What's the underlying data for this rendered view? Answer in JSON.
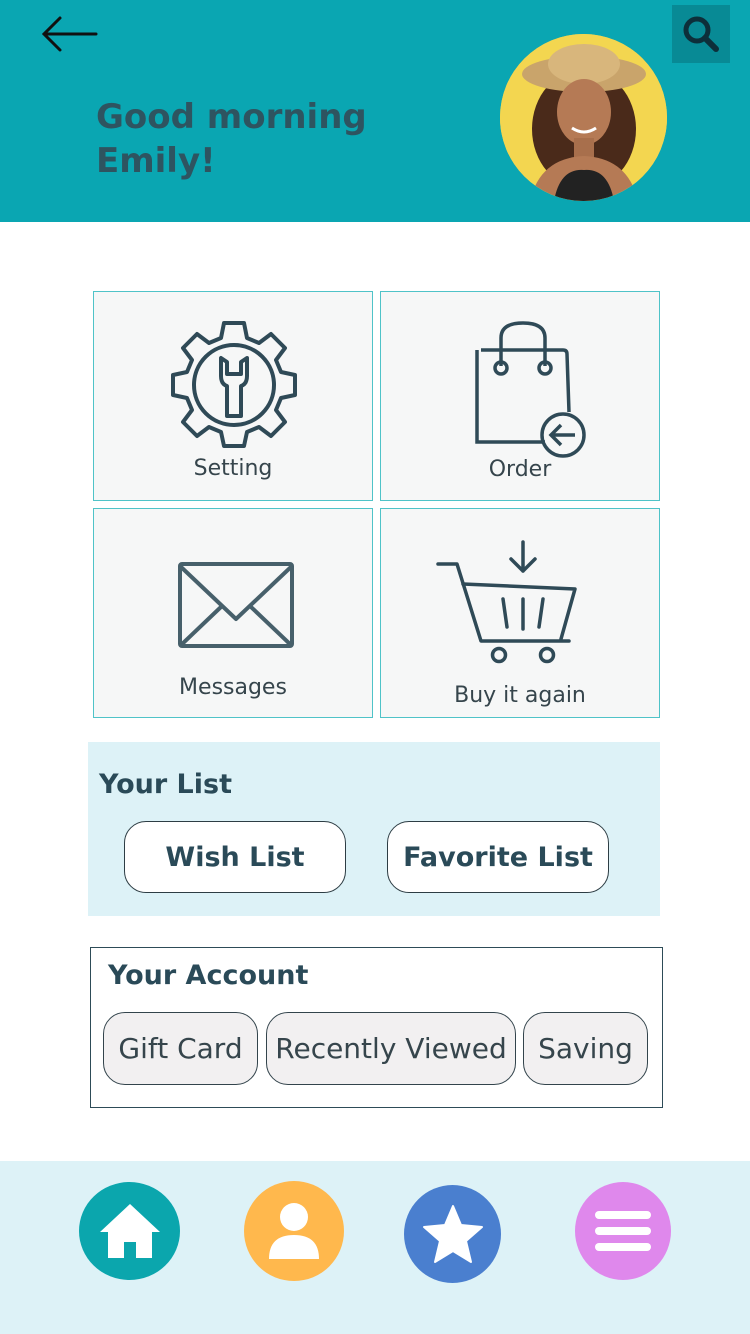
{
  "header": {
    "greeting_line1": "Good morning",
    "greeting_line2": "Emily!",
    "back_icon": "arrow-left-icon",
    "search_icon": "search-icon",
    "bg_color": "#0aa6b2"
  },
  "tiles": [
    {
      "label": "Setting",
      "icon": "gear-wrench-icon"
    },
    {
      "label": "Order",
      "icon": "shopping-bag-return-icon"
    },
    {
      "label": "Messages",
      "icon": "envelope-icon"
    },
    {
      "label": "Buy it again",
      "icon": "cart-download-icon"
    }
  ],
  "your_list": {
    "title": "Your List",
    "buttons": [
      "Wish List",
      "Favorite List"
    ]
  },
  "your_account": {
    "title": "Your Account",
    "buttons": [
      "Gift Card",
      "Recently Viewed",
      "Saving"
    ]
  },
  "bottom_nav": [
    {
      "name": "home",
      "icon": "home-icon",
      "color": "#0ba6ad"
    },
    {
      "name": "profile",
      "icon": "person-icon",
      "color": "#ffb84d"
    },
    {
      "name": "favorites",
      "icon": "star-icon",
      "color": "#4a7fcf"
    },
    {
      "name": "menu",
      "icon": "menu-icon",
      "color": "#df88ec"
    }
  ]
}
